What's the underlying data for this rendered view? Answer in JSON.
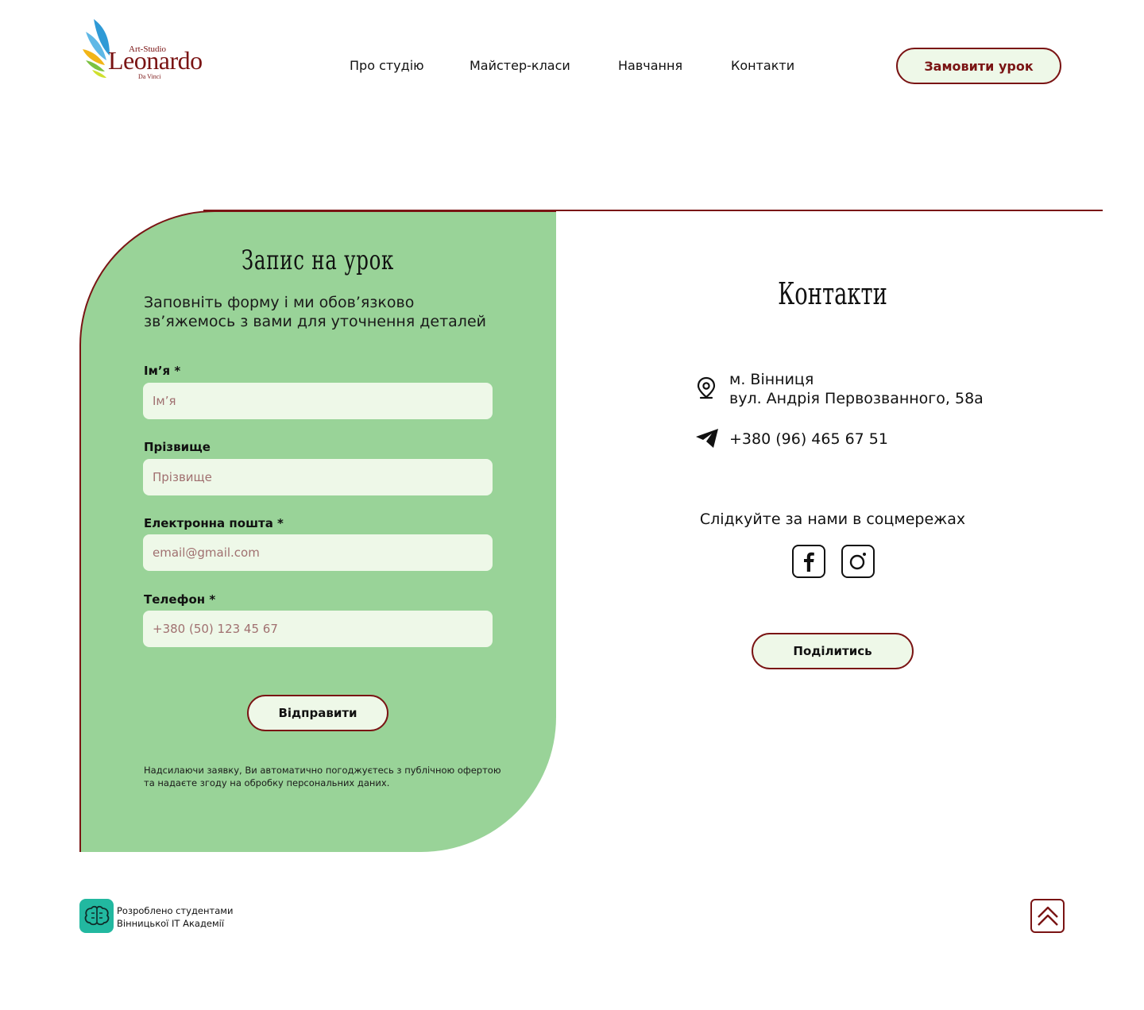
{
  "header": {
    "logo": {
      "studio": "Art-Studio",
      "brand": "Leonardo",
      "subtitle": "Da Vinci"
    },
    "nav": [
      {
        "label": "Про студію"
      },
      {
        "label": "Майстер-класи"
      },
      {
        "label": "Навчання"
      },
      {
        "label": "Контакти"
      }
    ],
    "order_button": "Замовити урок"
  },
  "form": {
    "title": "Запис на урок",
    "subtitle_line1": "Заповніть форму і ми обов’язково",
    "subtitle_line2": "зв’яжемось з вами для уточнення деталей",
    "fields": [
      {
        "label": "Ім’я *",
        "placeholder": "Ім’я"
      },
      {
        "label": "Прізвище",
        "placeholder": "Прізвище"
      },
      {
        "label": "Електронна пошта *",
        "placeholder": "email@gmail.com"
      },
      {
        "label": "Телефон *",
        "placeholder": "+380 (50) 123 45 67"
      }
    ],
    "submit": "Відправити",
    "consent_line1": "Надсилаючи заявку, Ви автоматично погоджуєтесь з публічною офертою",
    "consent_line2": "та надаєте згоду на обробку персональних даних."
  },
  "contacts": {
    "title": "Контакти",
    "city": "м. Вінниця",
    "street": "вул. Андрія Первозванного, 58а",
    "phone": "+380 (96) 465 67 51",
    "follow": "Слідкуйте за нами в соцмережах",
    "socials": [
      {
        "icon": "facebook-icon"
      },
      {
        "icon": "instagram-icon"
      }
    ],
    "share": "Поділитись"
  },
  "footer": {
    "dev_line1": "Розроблено студентами",
    "dev_line2": "Вінницької IT Академії",
    "to_top_icon": "chevron-up-double-icon"
  },
  "colors": {
    "accent": "#7a1414",
    "panel": "#99d398",
    "field_bg": "#eef8e8",
    "dev_logo": "#22b8a0"
  }
}
